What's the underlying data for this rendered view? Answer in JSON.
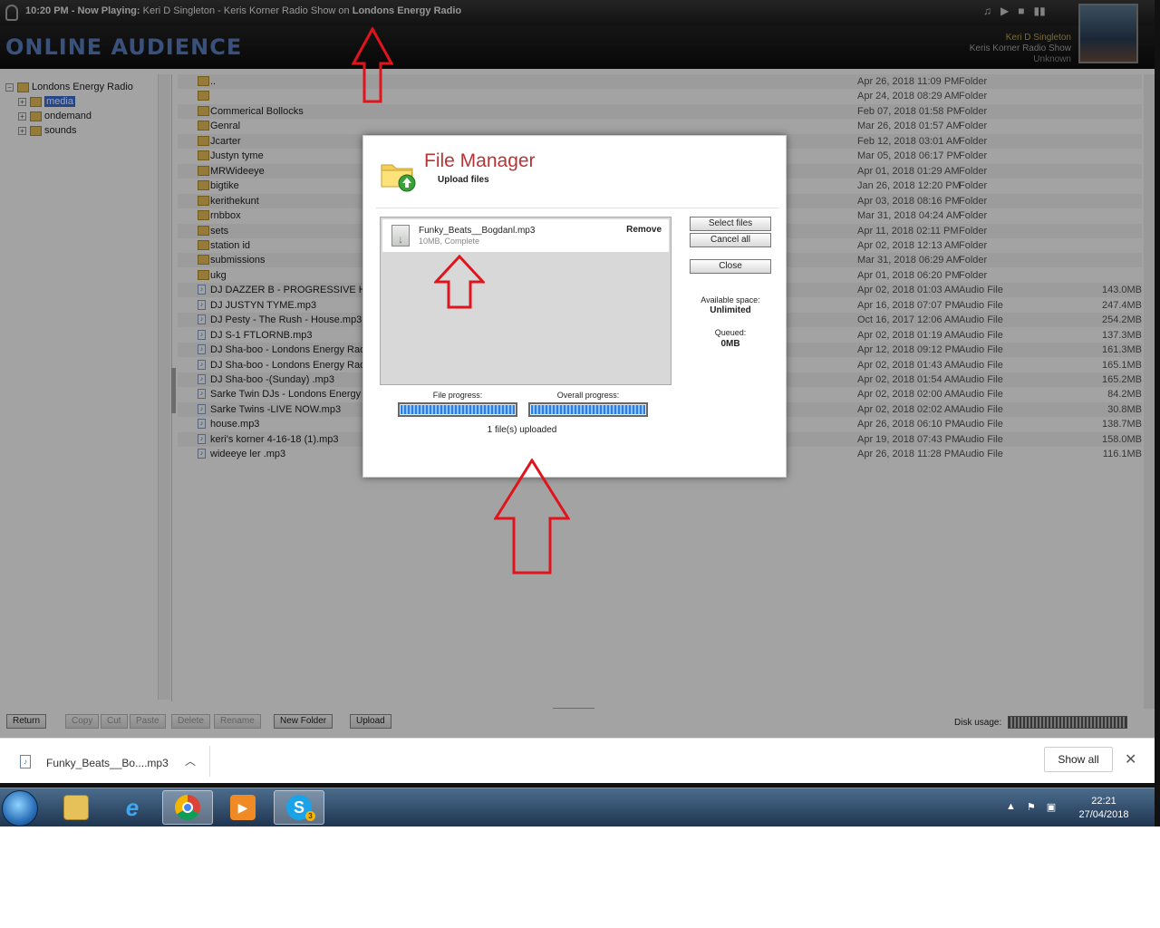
{
  "player": {
    "time": "10:20 PM",
    "now_playing_label": "Now Playing:",
    "now_playing_track": "Keri D Singleton - Keris Korner Radio Show on",
    "station": "Londons Energy Radio",
    "logo_text": "ONLINE AUDIENCE",
    "artist": "Keri D Singleton",
    "show": "Keris Korner Radio Show",
    "album": "Unknown"
  },
  "tree": {
    "root": "Londons Energy Radio",
    "children": [
      "media",
      "ondemand",
      "sounds"
    ]
  },
  "files": [
    {
      "name": "..",
      "date": "Apr 26, 2018 11:09 PM",
      "type": "Folder",
      "size": "",
      "kind": "folder"
    },
    {
      "name": "",
      "date": "Apr 24, 2018 08:29 AM",
      "type": "Folder",
      "size": "",
      "kind": "folder"
    },
    {
      "name": "Commerical Bollocks",
      "date": "Feb 07, 2018 01:58 PM",
      "type": "Folder",
      "size": "",
      "kind": "folder"
    },
    {
      "name": "Genral",
      "date": "Mar 26, 2018 01:57 AM",
      "type": "Folder",
      "size": "",
      "kind": "folder"
    },
    {
      "name": "Jcarter",
      "date": "Feb 12, 2018 03:01 AM",
      "type": "Folder",
      "size": "",
      "kind": "folder"
    },
    {
      "name": "Justyn tyme",
      "date": "Mar 05, 2018 06:17 PM",
      "type": "Folder",
      "size": "",
      "kind": "folder"
    },
    {
      "name": "MRWideeye",
      "date": "Apr 01, 2018 01:29 AM",
      "type": "Folder",
      "size": "",
      "kind": "folder"
    },
    {
      "name": "bigtike",
      "date": "Jan 26, 2018 12:20 PM",
      "type": "Folder",
      "size": "",
      "kind": "folder"
    },
    {
      "name": "kerithekunt",
      "date": "Apr 03, 2018 08:16 PM",
      "type": "Folder",
      "size": "",
      "kind": "folder"
    },
    {
      "name": "rnbbox",
      "date": "Mar 31, 2018 04:24 AM",
      "type": "Folder",
      "size": "",
      "kind": "folder"
    },
    {
      "name": "sets",
      "date": "Apr 11, 2018 02:11 PM",
      "type": "Folder",
      "size": "",
      "kind": "folder"
    },
    {
      "name": "station id",
      "date": "Apr 02, 2018 12:13 AM",
      "type": "Folder",
      "size": "",
      "kind": "folder"
    },
    {
      "name": "submissions",
      "date": "Mar 31, 2018 06:29 AM",
      "type": "Folder",
      "size": "",
      "kind": "folder"
    },
    {
      "name": "ukg",
      "date": "Apr 01, 2018 06:20 PM",
      "type": "Folder",
      "size": "",
      "kind": "folder"
    },
    {
      "name": "DJ DAZZER B - PROGRESSIVE HOUSE.",
      "date": "Apr 02, 2018 01:03 AM",
      "type": "Audio File",
      "size": "143.0MB",
      "kind": "file"
    },
    {
      "name": "DJ JUSTYN TYME.mp3",
      "date": "Apr 16, 2018 07:07 PM",
      "type": "Audio File",
      "size": "247.4MB",
      "kind": "file"
    },
    {
      "name": "DJ Pesty - The Rush - House.mp3",
      "date": "Oct 16, 2017 12:06 AM",
      "type": "Audio File",
      "size": "254.2MB",
      "kind": "file"
    },
    {
      "name": "DJ S-1 FTLORNB.mp3",
      "date": "Apr 02, 2018 01:19 AM",
      "type": "Audio File",
      "size": "137.3MB",
      "kind": "file"
    },
    {
      "name": "DJ Sha-boo - Londons Energy Radio (T",
      "date": "Apr 12, 2018 09:12 PM",
      "type": "Audio File",
      "size": "161.3MB",
      "kind": "file"
    },
    {
      "name": "DJ Sha-boo - Londons Energy Radio (V",
      "date": "Apr 02, 2018 01:43 AM",
      "type": "Audio File",
      "size": "165.1MB",
      "kind": "file"
    },
    {
      "name": "DJ Sha-boo -(Sunday) .mp3",
      "date": "Apr 02, 2018 01:54 AM",
      "type": "Audio File",
      "size": "165.2MB",
      "kind": "file"
    },
    {
      "name": "Sarke Twin DJs - Londons Energy Rad",
      "date": "Apr 02, 2018 02:00 AM",
      "type": "Audio File",
      "size": "84.2MB",
      "kind": "file"
    },
    {
      "name": "Sarke Twins -LIVE NOW.mp3",
      "date": "Apr 02, 2018 02:02 AM",
      "type": "Audio File",
      "size": "30.8MB",
      "kind": "file"
    },
    {
      "name": "house.mp3",
      "date": "Apr 26, 2018 06:10 PM",
      "type": "Audio File",
      "size": "138.7MB",
      "kind": "file"
    },
    {
      "name": "keri's korner 4-16-18 (1).mp3",
      "date": "Apr 19, 2018 07:43 PM",
      "type": "Audio File",
      "size": "158.0MB",
      "kind": "file"
    },
    {
      "name": "wideeye ler .mp3",
      "date": "Apr 26, 2018 11:28 PM",
      "type": "Audio File",
      "size": "116.1MB",
      "kind": "file"
    }
  ],
  "toolbar": {
    "return": "Return",
    "copy": "Copy",
    "cut": "Cut",
    "paste": "Paste",
    "delete": "Delete",
    "rename": "Rename",
    "new_folder": "New Folder",
    "upload": "Upload",
    "disk_usage": "Disk usage:"
  },
  "dialog": {
    "title": "File Manager",
    "subtitle": "Upload files",
    "file_name": "Funky_Beats__Bogdanl.mp3",
    "file_status": "10MB, Complete",
    "remove": "Remove",
    "select_files": "Select files",
    "cancel_all": "Cancel all",
    "close": "Close",
    "available_label": "Available space:",
    "available_value": "Unlimited",
    "queued_label": "Queued:",
    "queued_value": "0MB",
    "file_progress_label": "File progress:",
    "overall_progress_label": "Overall progress:",
    "file_progress": 1.0,
    "overall_progress": 1.0,
    "uploaded_text": "1 file(s) uploaded"
  },
  "downloads": {
    "item_name": "Funky_Beats__Bo....mp3",
    "show_all": "Show all"
  },
  "taskbar": {
    "time": "22:21",
    "date": "27/04/2018",
    "skype_badge": "3"
  },
  "colors": {
    "dialog_title": "#b83434",
    "annotation_arrow": "#e0141c",
    "selection": "#3a6fd8"
  }
}
